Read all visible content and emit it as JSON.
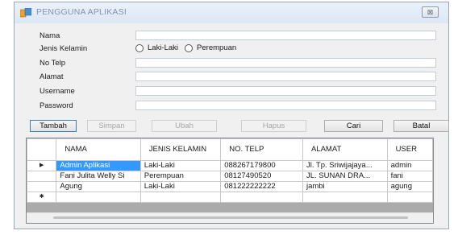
{
  "window": {
    "title": "PENGGUNA APLIKASI",
    "close_label": "⊠"
  },
  "form": {
    "nama_label": "Nama",
    "jenis_kelamin_label": "Jenis Kelamin",
    "radio_laki": "Laki-Laki",
    "radio_perempuan": "Perempuan",
    "no_telp_label": "No Telp",
    "alamat_label": "Alamat",
    "username_label": "Username",
    "password_label": "Password",
    "values": {
      "nama": "",
      "no_telp": "",
      "alamat": "",
      "username": "",
      "password": ""
    }
  },
  "buttons": {
    "tambah": "Tambah",
    "simpan": "Simpan",
    "ubah": "Ubah",
    "hapus": "Hapus",
    "cari": "Cari",
    "batal": "Batal"
  },
  "grid": {
    "columns": [
      "NAMA",
      "JENIS KELAMIN",
      "NO. TELP",
      "ALAMAT",
      "USER"
    ],
    "rows": [
      {
        "nama": "Admin Aplikasi",
        "jenis_kelamin": "Laki-Laki",
        "no_telp": "088267179800",
        "alamat": "Jl. Tp. Sriwijajaya...",
        "user": "admin"
      },
      {
        "nama": "Fani Julita Welly Si",
        "jenis_kelamin": "Perempuan",
        "no_telp": "08127490520",
        "alamat": "JL. SUNAN DRA...",
        "user": "fani"
      },
      {
        "nama": "Agung",
        "jenis_kelamin": "Laki-Laki",
        "no_telp": "081222222222",
        "alamat": "jambi",
        "user": "agung"
      }
    ],
    "current_row_marker": "▶",
    "new_row_marker": "✱"
  }
}
